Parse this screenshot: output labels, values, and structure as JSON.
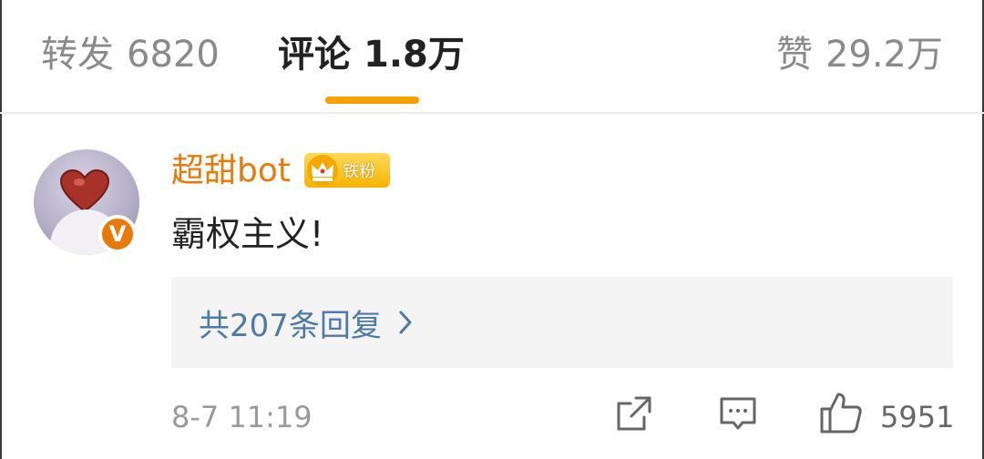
{
  "tabs": {
    "repost": {
      "label": "转发",
      "count": "6820"
    },
    "comments": {
      "label": "评论",
      "count": "1.8万"
    },
    "likes": {
      "label": "赞",
      "count": "29.2万"
    }
  },
  "comment": {
    "username": "超甜bot",
    "verified_badge": "V",
    "fan_badge": "铁粉",
    "text": "霸权主义!",
    "replies_label": "共207条回复",
    "timestamp": "8-7 11:19",
    "like_count": "5951"
  },
  "icons": {
    "share": "share-icon",
    "reply": "comment-icon",
    "like": "thumbs-up-icon",
    "chevron": "chevron-right-icon",
    "crown": "crown-icon"
  },
  "colors": {
    "accent": "#f7a100",
    "username": "#e8790b",
    "link": "#4d7aa8",
    "muted": "#9a9a9a"
  }
}
